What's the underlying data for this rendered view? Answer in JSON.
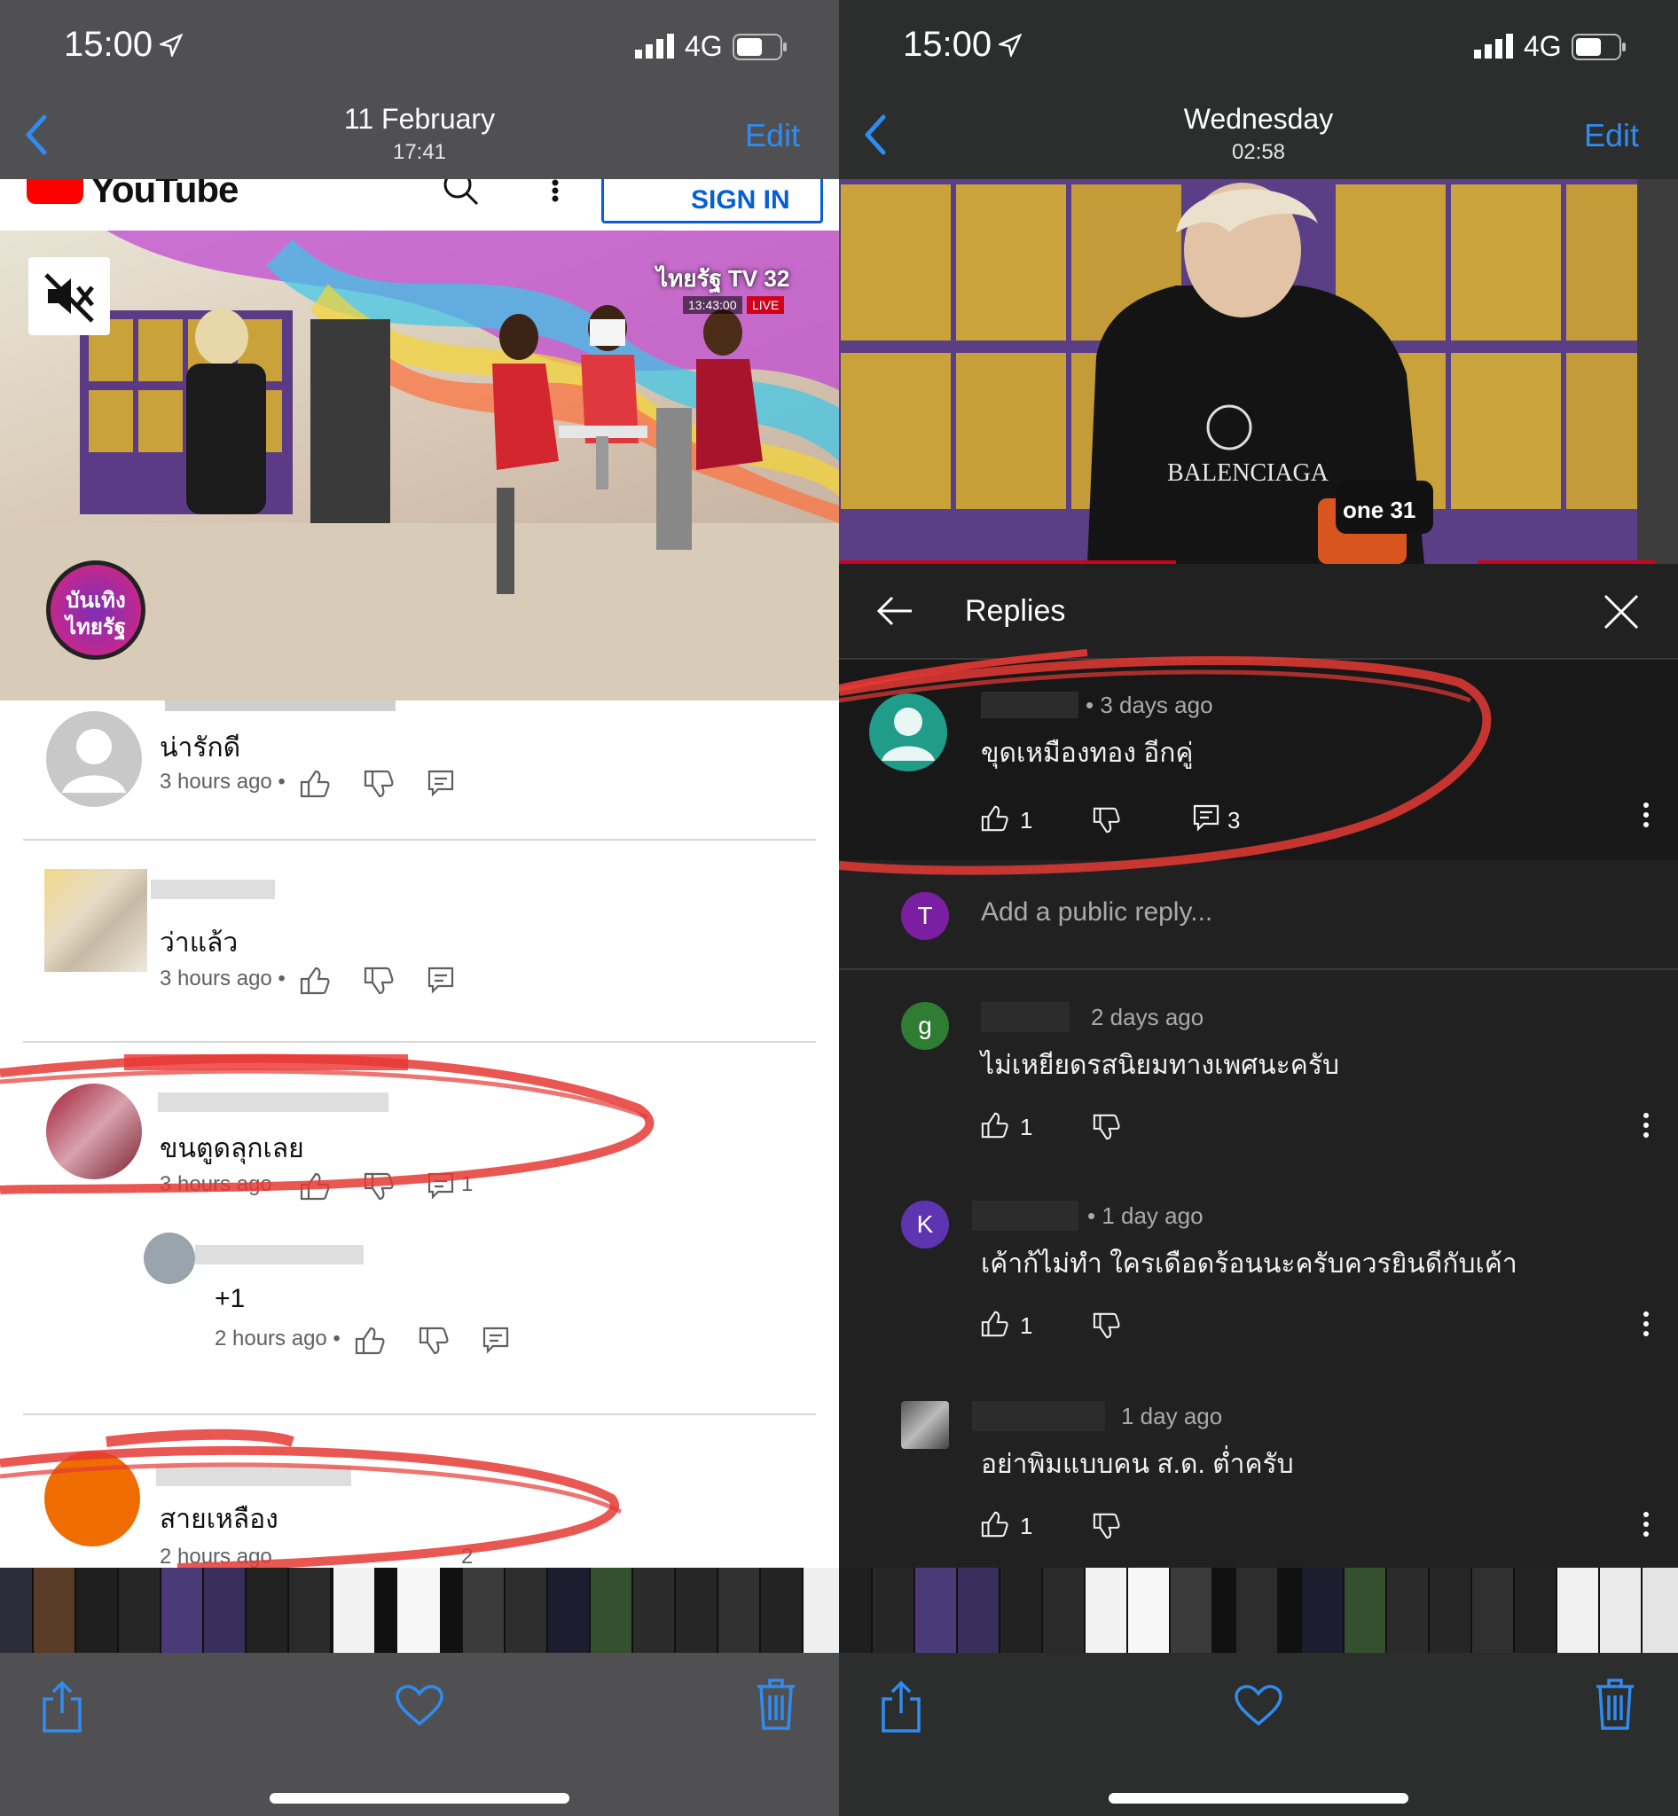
{
  "left": {
    "status": {
      "time": "15:00",
      "network": "4G"
    },
    "nav": {
      "title": "11 February",
      "subtitle": "17:41",
      "edit": "Edit"
    },
    "youtube": {
      "logo_text": "YouTube",
      "signin_label": "SIGN IN"
    },
    "video": {
      "channel": "ไทยรัฐ TV 32",
      "clock": "13:43:00",
      "live": "LIVE",
      "show_badge": "บันเทิง ไทยรัฐ"
    },
    "comments": [
      {
        "text": "น่ารักดี",
        "time": "3 hours ago •",
        "reply_count": ""
      },
      {
        "text": "ว่าแล้ว",
        "time": "3 hours ago •",
        "reply_count": ""
      },
      {
        "text": "ขนตูดลุกเลย",
        "time": "3 hours ago",
        "reply_count": "1"
      },
      {
        "text": "+1",
        "time": "2 hours ago •",
        "reply_count": ""
      },
      {
        "text": "สายเหลือง",
        "time": "2 hours ago",
        "reply_count": "2"
      }
    ]
  },
  "right": {
    "status": {
      "time": "15:00",
      "network": "4G"
    },
    "nav": {
      "title": "Wednesday",
      "subtitle": "02:58",
      "edit": "Edit"
    },
    "video": {
      "shirt_brand": "BALENCIAGA",
      "mic_logo": "one 31"
    },
    "replies_title": "Replies",
    "parent": {
      "time": "• 3 days ago",
      "text": "ขุดเหมืองทอง อีกคู่",
      "likes": "1",
      "replies": "3"
    },
    "add_reply": {
      "avatar_letter": "T",
      "placeholder": "Add a public reply..."
    },
    "replies": [
      {
        "avatar": "g",
        "avatar_color": "#2e7d32",
        "time": "2 days ago",
        "text": "ไม่เหยียดรสนิยมทางเพศนะครับ",
        "likes": "1"
      },
      {
        "avatar": "K",
        "avatar_color": "#5e35b1",
        "time": "• 1 day ago",
        "text": "เค้าก้ไม่ทำ ใครเดือดร้อนนะครับควรยินดีกับเค้า",
        "likes": "1"
      },
      {
        "avatar": "",
        "avatar_color": "#777777",
        "time": "1 day ago",
        "text": "อย่าพิมแบบคน ส.ด. ต่ำครับ",
        "likes": "1"
      }
    ]
  },
  "colors": {
    "ios_blue": "#2f8cf0",
    "annotation_red": "#e53935",
    "yt_red": "#ff0000"
  }
}
